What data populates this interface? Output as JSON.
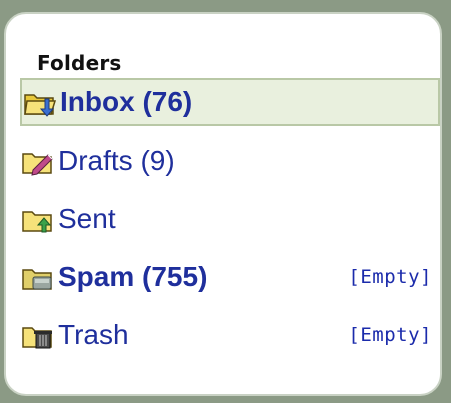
{
  "panel": {
    "title": "Folders"
  },
  "folders": [
    {
      "label": "Inbox (76)",
      "icon": "inbox-folder-icon",
      "selected": true,
      "bold": true,
      "empty_label": ""
    },
    {
      "label": "Drafts (9)",
      "icon": "drafts-folder-icon",
      "selected": false,
      "bold": false,
      "empty_label": ""
    },
    {
      "label": "Sent",
      "icon": "sent-folder-icon",
      "selected": false,
      "bold": false,
      "empty_label": ""
    },
    {
      "label": "Spam (755)",
      "icon": "spam-folder-icon",
      "selected": false,
      "bold": true,
      "empty_label": "[Empty]"
    },
    {
      "label": "Trash",
      "icon": "trash-folder-icon",
      "selected": false,
      "bold": false,
      "empty_label": "[Empty]"
    }
  ],
  "colors": {
    "link": "#1f2f9c",
    "selected_bg": "#e9f0de",
    "selected_border": "#b9c8a6",
    "folder_yellow": "#f5d94a"
  }
}
